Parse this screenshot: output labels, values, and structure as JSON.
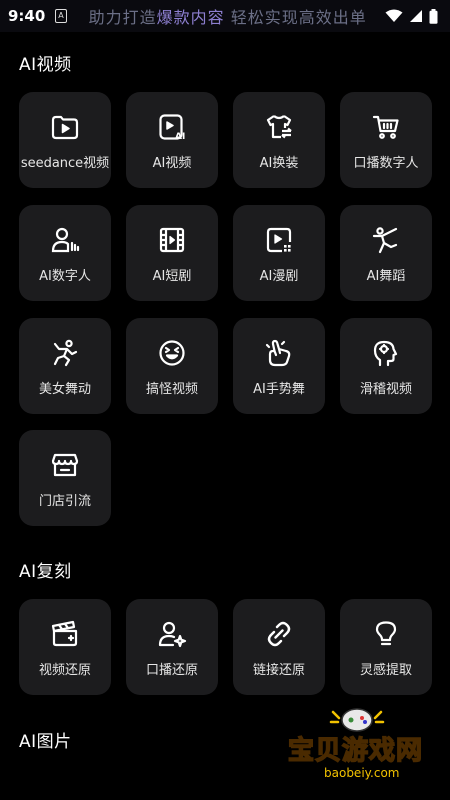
{
  "status_bar": {
    "time": "9:40",
    "a_badge": "A",
    "banner_prefix": "助力打造",
    "banner_highlight": "爆款内容",
    "banner_suffix": "  轻松实现高效出单"
  },
  "sections": {
    "ai_video": {
      "title": "AI视频",
      "items": [
        {
          "label": "seedance视频",
          "icon": "folder-play-icon"
        },
        {
          "label": "AI视频",
          "icon": "ai-video-icon"
        },
        {
          "label": "AI换装",
          "icon": "shirt-swap-icon"
        },
        {
          "label": "口播数字人",
          "icon": "cart-icon"
        },
        {
          "label": "AI数字人",
          "icon": "person-voice-icon"
        },
        {
          "label": "AI短剧",
          "icon": "film-icon"
        },
        {
          "label": "AI漫剧",
          "icon": "play-grid-icon"
        },
        {
          "label": "AI舞蹈",
          "icon": "dancer-icon"
        },
        {
          "label": "美女舞动",
          "icon": "jump-dancer-icon"
        },
        {
          "label": "搞怪视频",
          "icon": "funny-face-icon"
        },
        {
          "label": "AI手势舞",
          "icon": "hand-gesture-icon"
        },
        {
          "label": "滑稽视频",
          "icon": "head-icon"
        },
        {
          "label": "门店引流",
          "icon": "store-icon"
        }
      ]
    },
    "ai_replica": {
      "title": "AI复刻",
      "items": [
        {
          "label": "视频还原",
          "icon": "clapper-icon"
        },
        {
          "label": "口播还原",
          "icon": "person-sparkle-icon"
        },
        {
          "label": "链接还原",
          "icon": "link-icon"
        },
        {
          "label": "灵感提取",
          "icon": "bulb-icon"
        }
      ]
    },
    "ai_image": {
      "title": "AI图片"
    }
  },
  "watermark": {
    "main": "宝贝游戏网",
    "sub": "baobeiy.com"
  }
}
